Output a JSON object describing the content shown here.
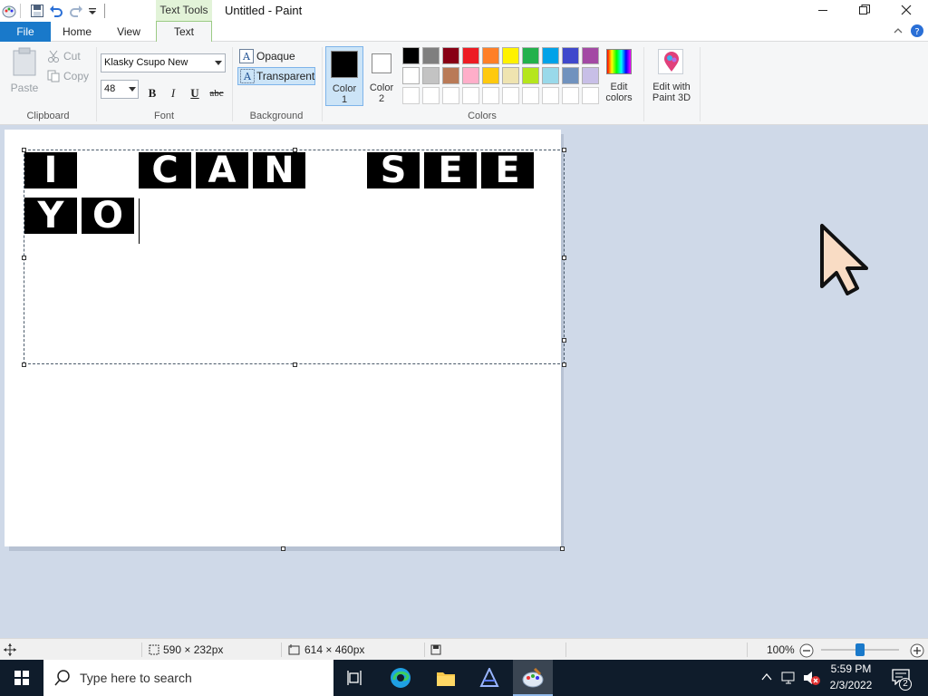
{
  "titlebar": {
    "context_tab": "Text Tools",
    "title": "Untitled - Paint",
    "minimize_icon": "minimize-icon",
    "maximize_icon": "restore-icon",
    "close_icon": "close-icon"
  },
  "tabs": {
    "file": "File",
    "home": "Home",
    "view": "View",
    "text": "Text"
  },
  "ribbon": {
    "clipboard": {
      "paste": "Paste",
      "cut": "Cut",
      "copy": "Copy",
      "label": "Clipboard"
    },
    "font": {
      "family": "Klasky Csupo New",
      "size": "48",
      "bold": "B",
      "italic": "I",
      "underline": "U",
      "strike": "abc",
      "label": "Font"
    },
    "background": {
      "opaque": "Opaque",
      "transparent": "Transparent",
      "label": "Background",
      "selected": "Transparent"
    },
    "colors": {
      "color1_line1": "Color",
      "color1_line2": "1",
      "color2_line1": "Color",
      "color2_line2": "2",
      "label": "Colors",
      "edit_line1": "Edit",
      "edit_line2": "colors",
      "color1": "#000000",
      "color2": "#ffffff",
      "row1": [
        "#000000",
        "#7f7f7f",
        "#880015",
        "#ed1c24",
        "#ff7f27",
        "#fff200",
        "#22b14c",
        "#00a2e8",
        "#3f48cc",
        "#a349a4"
      ],
      "row2": [
        "#ffffff",
        "#c3c3c3",
        "#b97a57",
        "#ffaec9",
        "#ffc90e",
        "#efe4b0",
        "#b5e61d",
        "#99d9ea",
        "#7092be",
        "#c8bfe7"
      ]
    },
    "paint3d": {
      "line1": "Edit with",
      "line2": "Paint 3D"
    }
  },
  "canvas": {
    "text_line1": [
      "I",
      "",
      "C",
      "A",
      "N",
      "",
      "S",
      "E",
      "E"
    ],
    "text_line2": [
      "Y",
      "O"
    ]
  },
  "status": {
    "selection_size": "590 × 232px",
    "canvas_size": "614 × 460px",
    "zoom": "100%",
    "zoom_level": 0.5
  },
  "taskbar": {
    "search_placeholder": "Type here to search",
    "time": "5:59 PM",
    "date": "2/3/2022",
    "notification_count": "2"
  }
}
